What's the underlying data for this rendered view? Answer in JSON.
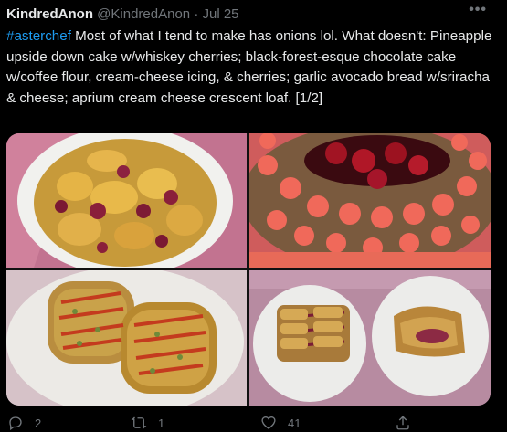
{
  "tweet": {
    "display_name": "KindredAnon",
    "handle": "@KindredAnon",
    "separator": "·",
    "date": "Jul 25",
    "more_icon": "•••",
    "hashtag": "#asterchef",
    "text": " Most of what I tend to make has onions lol. What doesn't: Pineapple upside down cake w/whiskey cherries; black-forest-esque chocolate cake w/coffee flour, cream-cheese icing, & cherries; garlic avocado bread w/sriracha & cheese; aprium cream cheese crescent loaf. [1/2]"
  },
  "actions": {
    "reply_count": "2",
    "retweet_count": "1",
    "like_count": "41"
  },
  "colors": {
    "background": "#000000",
    "text": "#e7e9ea",
    "muted": "#71767b",
    "accent": "#1d9bf0"
  },
  "icons": [
    "more-icon",
    "reply-icon",
    "retweet-icon",
    "like-icon",
    "share-icon"
  ]
}
